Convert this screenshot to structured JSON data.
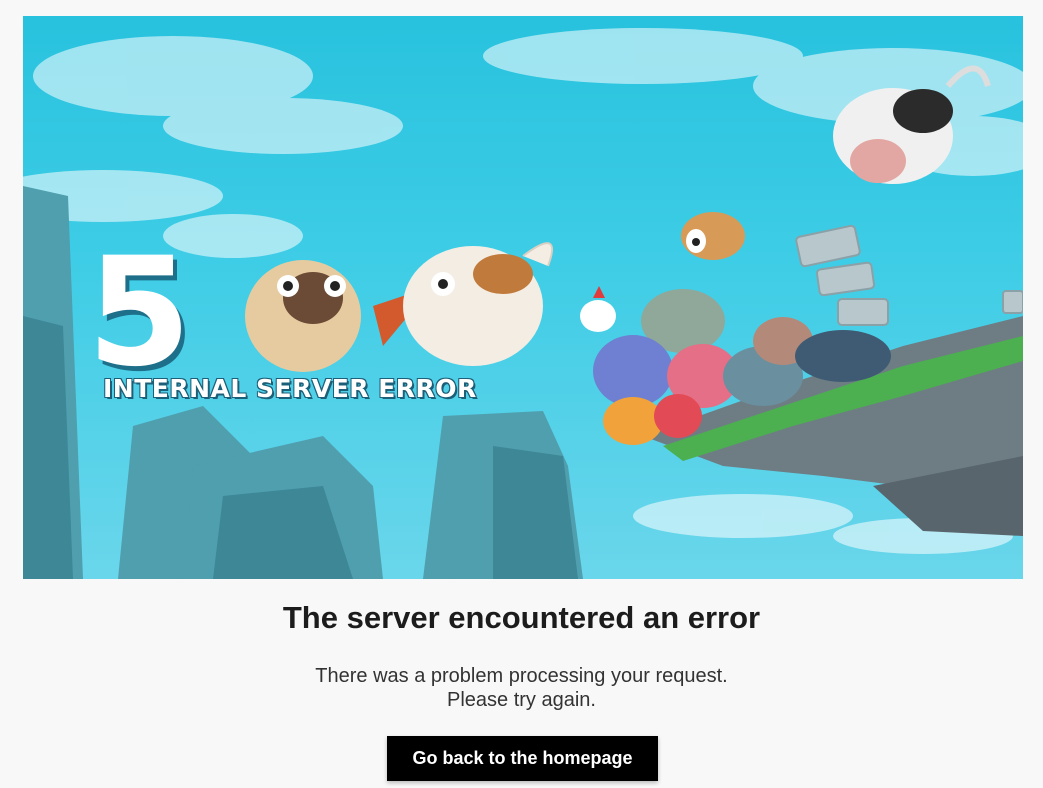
{
  "hero": {
    "digit": "5",
    "caption": "INTERNAL SERVER ERROR",
    "sky_color": "#3fcde6",
    "rock_color": "#4f9fae"
  },
  "content": {
    "title": "The server encountered an error",
    "message_line1": "There was a problem processing your request.",
    "message_line2": "Please try again."
  },
  "actions": {
    "home_button_label": "Go back to the homepage"
  }
}
